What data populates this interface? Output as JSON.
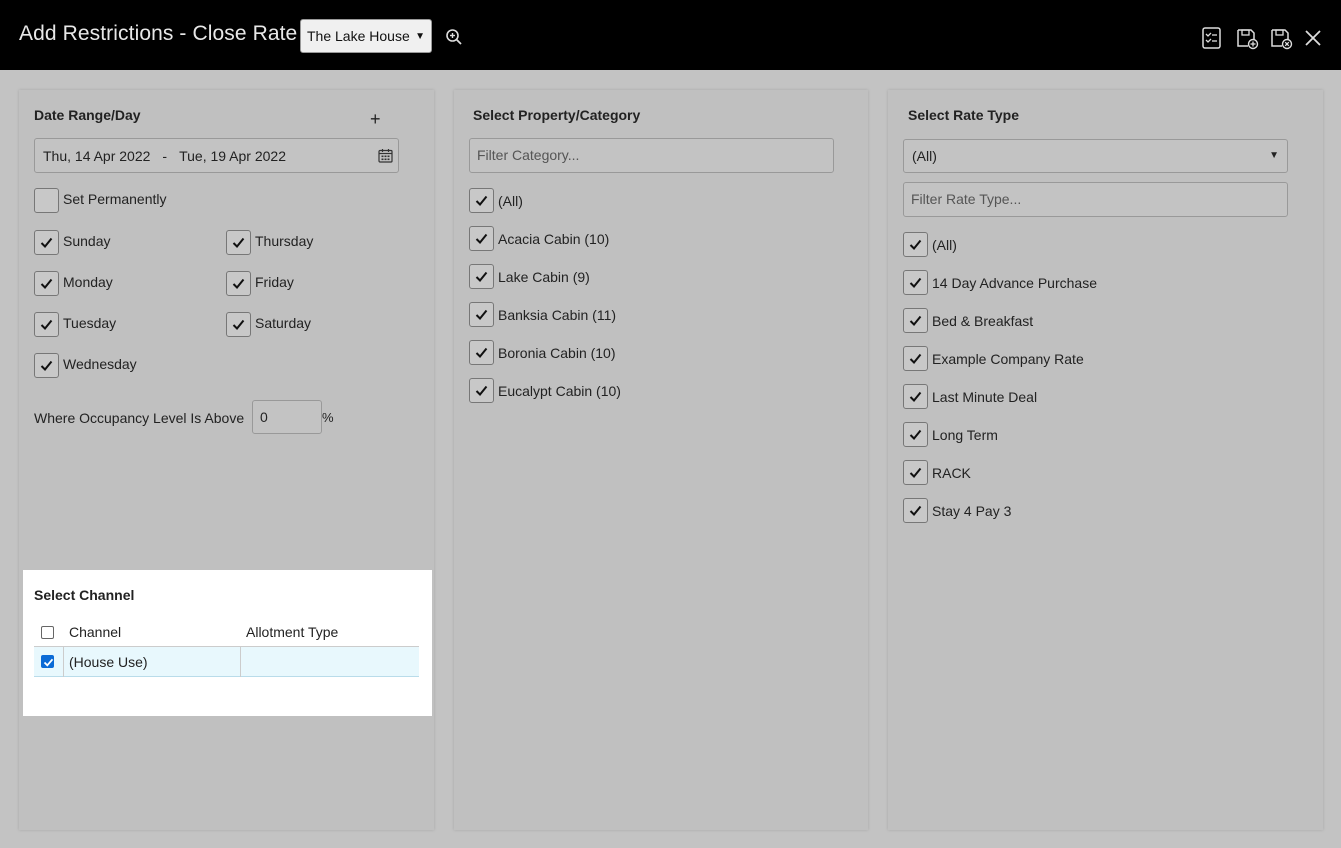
{
  "header": {
    "title": "Add Restrictions - Close Rate",
    "property_select": "The Lake House",
    "icons": [
      "search-zoom-icon",
      "checklist-icon",
      "save-add-icon",
      "save-close-icon",
      "close-icon"
    ]
  },
  "date_panel": {
    "title": "Date Range/Day",
    "add_label": "+",
    "date_from": "Thu, 14 Apr 2022",
    "date_separator": "-",
    "date_to": "Tue, 19 Apr 2022",
    "set_permanently_label": "Set Permanently",
    "days": {
      "sunday": "Sunday",
      "monday": "Monday",
      "tuesday": "Tuesday",
      "wednesday": "Wednesday",
      "thursday": "Thursday",
      "friday": "Friday",
      "saturday": "Saturday"
    },
    "occupancy_label": "Where Occupancy Level Is Above",
    "occupancy_value": "0",
    "occupancy_unit": "%"
  },
  "channel": {
    "title": "Select Channel",
    "col_channel": "Channel",
    "col_allotment": "Allotment Type",
    "rows": [
      {
        "channel": "(House Use)",
        "allotment": "",
        "checked": true
      }
    ]
  },
  "category_panel": {
    "title": "Select Property/Category",
    "filter_placeholder": "Filter Category...",
    "items": [
      "(All)",
      "Acacia Cabin (10)",
      "Lake Cabin (9)",
      "Banksia Cabin (11)",
      "Boronia Cabin (10)",
      "Eucalypt Cabin (10)"
    ]
  },
  "rate_panel": {
    "title": "Select Rate Type",
    "select_value": "(All)",
    "filter_placeholder": "Filter Rate Type...",
    "items": [
      "(All)",
      "14 Day Advance Purchase",
      "Bed & Breakfast",
      "Example Company Rate",
      "Last Minute Deal",
      "Long Term",
      "RACK",
      "Stay 4 Pay 3"
    ]
  }
}
